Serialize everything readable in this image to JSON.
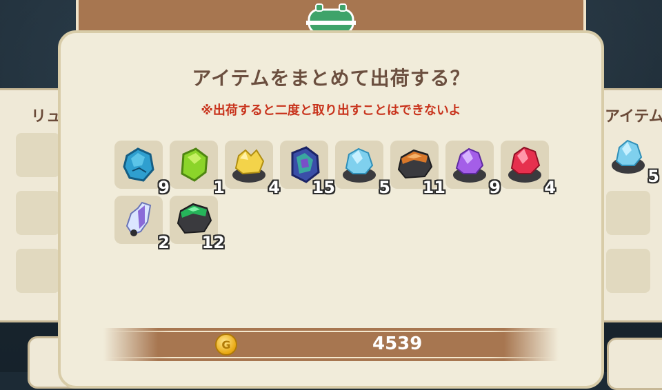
{
  "left_panel": {
    "title": "リュ"
  },
  "right_panel": {
    "title": "アイテム",
    "item": {
      "name": "blue-crystal",
      "qty": "5"
    }
  },
  "dialog": {
    "title": "アイテムをまとめて出荷する？",
    "warning": "※出荷すると二度と取り出すことはできないよ"
  },
  "items": [
    {
      "name": "blue-gem",
      "qty": "9"
    },
    {
      "name": "green-gem",
      "qty": "1"
    },
    {
      "name": "yellow-crystal",
      "qty": "4"
    },
    {
      "name": "opal",
      "qty": "15"
    },
    {
      "name": "blue-crystal",
      "qty": "5"
    },
    {
      "name": "amber-ore",
      "qty": "11"
    },
    {
      "name": "purple-crystal",
      "qty": "9"
    },
    {
      "name": "red-crystal",
      "qty": "4"
    },
    {
      "name": "quartz",
      "qty": "2"
    },
    {
      "name": "green-ore",
      "qty": "12"
    }
  ],
  "gold": {
    "icon": "coin-icon",
    "value": "4539"
  },
  "colors": {
    "dialog_bg": "#f1ecda",
    "accent_brown": "#a77650",
    "warning_red": "#c8331c",
    "title_brown": "#6b4f3f"
  }
}
